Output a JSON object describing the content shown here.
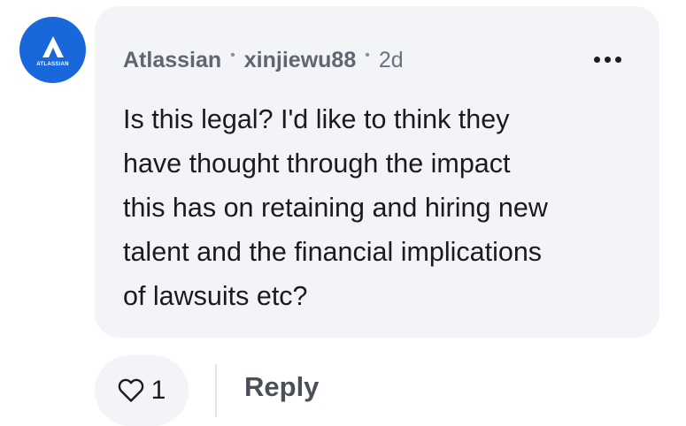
{
  "comment": {
    "avatar_text": "ATLASSIAN",
    "company": "Atlassian",
    "username": "xinjiewu88",
    "age": "2d",
    "separator": "•",
    "text": "Is this legal? I'd like to think they\nhave thought through the impact\nthis has on retaining and hiring new\ntalent and the financial implications\nof lawsuits etc?"
  },
  "actions": {
    "like_count": "1",
    "reply_label": "Reply",
    "more_icon": "more-horizontal-icon",
    "like_icon": "heart-icon"
  },
  "colors": {
    "avatar_bg": "#1868db",
    "bubble_bg": "#f3f4f8",
    "text": "#1b1b1b",
    "meta": "#6b7280"
  }
}
